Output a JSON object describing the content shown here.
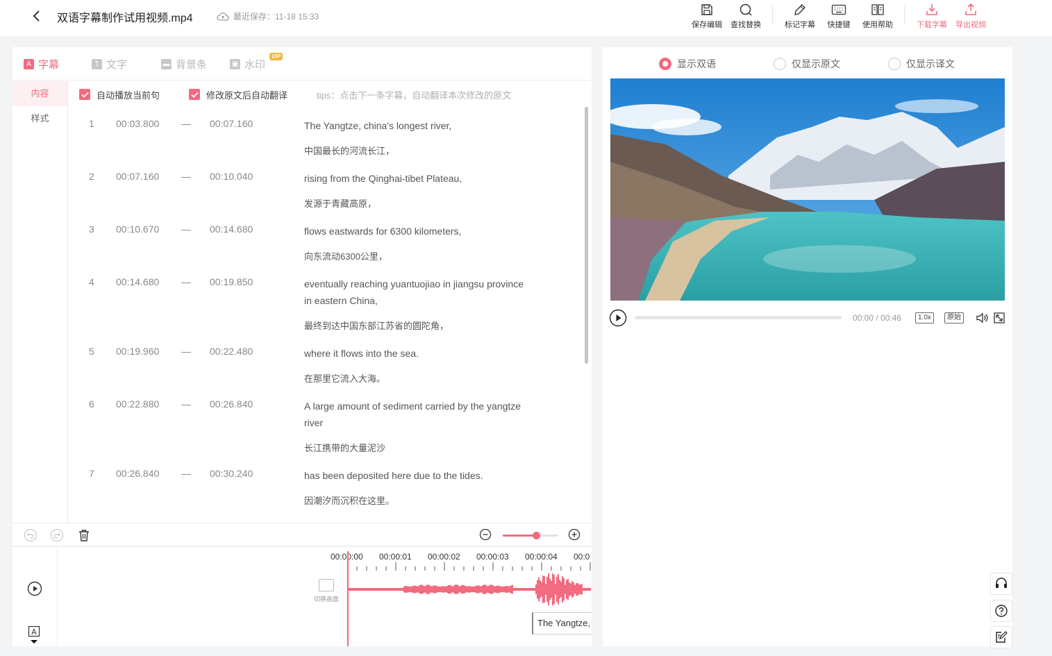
{
  "header": {
    "filename": "双语字幕制作试用视频.mp4",
    "save_status": "最近保存：11-18 15:33",
    "tools": {
      "save": "保存编辑",
      "find": "查找替换",
      "mark": "标记字幕",
      "shortcuts": "快捷键",
      "help": "使用帮助",
      "download": "下载字幕",
      "export": "导出视频"
    }
  },
  "editor": {
    "tabs": {
      "subtitle": "字幕",
      "text": "文字",
      "background": "背景条",
      "watermark": "水印",
      "vip_badge": "VIP"
    },
    "sidenav": {
      "content": "内容",
      "style": "样式"
    },
    "options": {
      "autoplay": "自动播放当前句",
      "autotranslate": "修改原文后自动翻译",
      "tips": "tips：点击下一条字幕，自动翻译本次修改的原文"
    },
    "dash": "—",
    "subtitles": [
      {
        "index": "1",
        "start": "00:03.800",
        "end": "00:07.160",
        "source": "The Yangtze, china's longest river,",
        "translation": "中国最长的河流长江，"
      },
      {
        "index": "2",
        "start": "00:07.160",
        "end": "00:10.040",
        "source": "rising from the Qinghai-tibet Plateau,",
        "translation": "发源于青藏高原，"
      },
      {
        "index": "3",
        "start": "00:10.670",
        "end": "00:14.680",
        "source": "flows eastwards for 6300 kilometers,",
        "translation": "向东流动6300公里，"
      },
      {
        "index": "4",
        "start": "00:14.680",
        "end": "00:19.850",
        "source": "eventually reaching yuantuojiao in jiangsu province in eastern China,",
        "translation": "最终到达中国东部江苏省的圆陀角，"
      },
      {
        "index": "5",
        "start": "00:19.960",
        "end": "00:22.480",
        "source": "where it flows into the sea.",
        "translation": "在那里它流入大海。"
      },
      {
        "index": "6",
        "start": "00:22.880",
        "end": "00:26.840",
        "source": "A large amount of sediment carried by the yangtze river",
        "translation": "长江携带的大量泥沙"
      },
      {
        "index": "7",
        "start": "00:26.840",
        "end": "00:30.240",
        "source": "has been deposited here due to the tides.",
        "translation": "因潮汐而沉积在这里。"
      }
    ]
  },
  "timeline": {
    "zoom_level": 0.6,
    "ticks": [
      "00:00:00",
      "00:00:01",
      "00:00:02",
      "00:00:03",
      "00:00:04",
      "00:0"
    ],
    "switch_frame": "切换画面",
    "clip_text": "The Yangtze, c"
  },
  "preview": {
    "modes": {
      "bilingual": "显示双语",
      "original": "仅显示原文",
      "translated": "仅显示译文"
    },
    "selected_mode": "bilingual",
    "time": "00:00 / 00:46",
    "speed": "1.0x",
    "ratio": "原始",
    "progress": 0
  },
  "colors": {
    "accent": "#f26b7f",
    "water": "#3fb8b6",
    "sky": "#1f7fd1"
  }
}
